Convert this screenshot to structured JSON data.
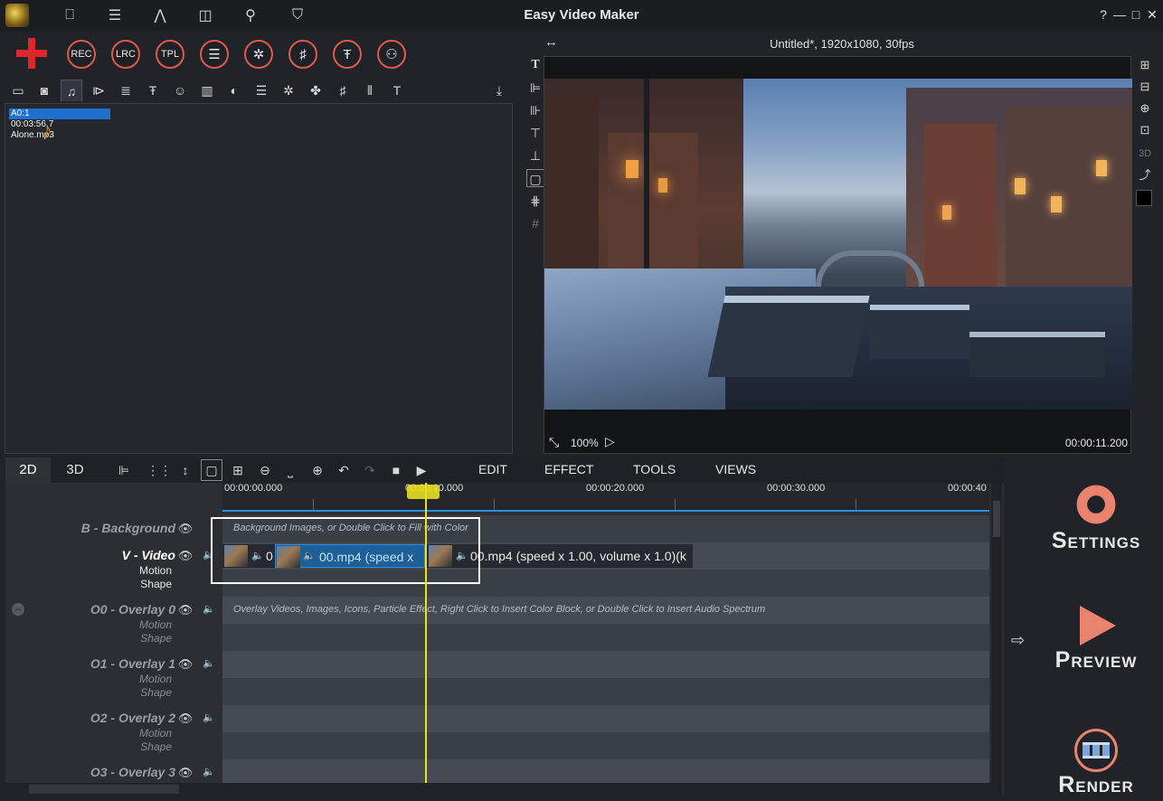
{
  "window": {
    "title": "Easy Video Maker",
    "controls": [
      "?",
      "—",
      "□",
      "✕"
    ]
  },
  "big_toolbar": {
    "buttons": [
      "REC",
      "LRC",
      "TPL",
      "",
      "",
      "",
      "",
      ""
    ]
  },
  "media": {
    "selected_label": "A0:1",
    "duration": "00:03:56.7",
    "filename": "Alone.mp3"
  },
  "preview": {
    "title": "Untitled*, 1920x1080, 30fps",
    "zoom": "100%",
    "time": "00:00:11.200"
  },
  "timeline_tabs": {
    "tab_2d": "2D",
    "tab_3d": "3D"
  },
  "menus": {
    "edit": "EDIT",
    "effect": "EFFECT",
    "tools": "TOOLS",
    "views": "VIEWS"
  },
  "ruler": {
    "labels": [
      "00:00:00.000",
      "00:00:10.000",
      "00:00:20.000",
      "00:00:30.000",
      "00:00:40"
    ]
  },
  "tracks": {
    "background": {
      "label": "B - Background",
      "hint": "Background Images, or Double Click to Fill with Color"
    },
    "video": {
      "label": "V - Video",
      "sub1": "Motion",
      "sub2": "Shape",
      "clip1_text": "0",
      "clip2_text": "00.mp4  (speed x",
      "clip3_text": "00.mp4  (speed x 1.00, volume x 1.0)(k"
    },
    "overlay0": {
      "label": "O0 - Overlay 0",
      "sub1": "Motion",
      "sub2": "Shape",
      "hint": "Overlay Videos, Images, Icons, Particle Effect, Right Click to Insert Color Block, or Double  Click to Insert Audio Spectrum"
    },
    "overlay1": {
      "label": "O1 - Overlay 1",
      "sub1": "Motion",
      "sub2": "Shape"
    },
    "overlay2": {
      "label": "O2 - Overlay 2",
      "sub1": "Motion",
      "sub2": "Shape"
    },
    "overlay3": {
      "label": "O3 - Overlay 3"
    }
  },
  "side": {
    "settings_cap": "S",
    "settings_rest": "ETTINGS",
    "preview_cap": "P",
    "preview_rest": "REVIEW",
    "render_cap": "R",
    "render_rest": "ENDER"
  },
  "colors": {
    "accent_blue": "#1f6fcf",
    "record_red": "#e05a4a",
    "playhead_yellow": "#e8e020",
    "preview_orange": "#e9836e"
  }
}
